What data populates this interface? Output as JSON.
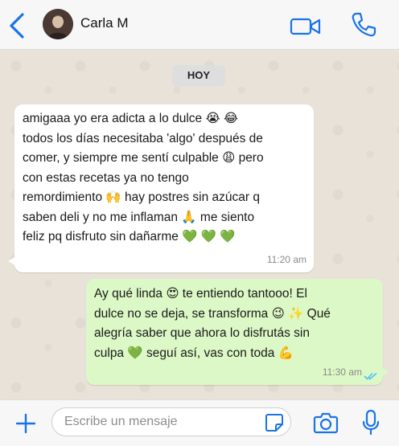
{
  "header": {
    "contact_name": "Carla M",
    "icons": {
      "back": "chevron-left-icon",
      "video": "video-camera-icon",
      "call": "phone-icon"
    }
  },
  "chat": {
    "day_label": "HOY",
    "messages": [
      {
        "direction": "incoming",
        "text": "amigaaa yo era adicta a lo dulce 😭 😂\ntodos los días necesitaba 'algo' después de\ncomer, y siempre me sentí culpable 😩  pero\ncon estas recetas ya no tengo\nremordimiento 🙌  hay postres sin azúcar q\nsaben deli y no me inflaman 🙏  me siento\nfeliz pq disfruto sin dañarme 💚 💚 💚",
        "time": "11:20 am"
      },
      {
        "direction": "outgoing",
        "text": "Ay qué linda 😍  te entiendo tantooo! El\ndulce no se deja, se transforma 😉 ✨  Qué\nalegría saber que ahora lo disfrutás sin\nculpa 💚  seguí así, vas con toda 💪",
        "time": "11:30 am",
        "status": "read"
      }
    ]
  },
  "footer": {
    "input_placeholder": "Escribe un mensaje",
    "input_value": "",
    "icons": {
      "add": "plus-icon",
      "sticker": "sticker-icon",
      "camera": "camera-icon",
      "mic": "microphone-icon"
    }
  },
  "colors": {
    "accent": "#1a73e8",
    "outgoing_bubble": "#dcf8c6",
    "incoming_bubble": "#ffffff",
    "read_checks": "#4fc3f7"
  }
}
